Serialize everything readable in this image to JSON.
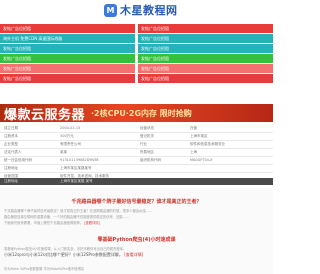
{
  "header": {
    "logo_mark": "M",
    "logo_text": "木星教程网"
  },
  "banners": {
    "left": [
      {
        "label": "发帖广告位招租",
        "color": "red"
      },
      {
        "label": "海外主机 免费CDN 高速国际线路",
        "color": "teal"
      },
      {
        "label": "发帖广告位招租",
        "color": "teal"
      },
      {
        "label": "发帖广告位招租",
        "color": "green"
      },
      {
        "label": "发帖广告位招租",
        "color": "pink"
      },
      {
        "label": "发帖广告位招租",
        "color": "red"
      }
    ],
    "right": [
      {
        "label": "发帖广告位招租",
        "color": "red"
      },
      {
        "label": "发帖广告位招租",
        "color": "teal"
      },
      {
        "label": "发帖广告位招租",
        "color": "teal"
      },
      {
        "label": "发帖广告位招租",
        "color": "green"
      },
      {
        "label": "发帖广告位招租",
        "color": "pink"
      },
      {
        "label": "发帖广告位招租",
        "color": "red"
      }
    ]
  },
  "big_banner": {
    "title": "爆款云服务器",
    "subtitle": "·2核CPU·2G内存 限时抢购"
  },
  "info_rows": [
    [
      "成立日期",
      "2004-02-15",
      "经营状态",
      "在营"
    ],
    [
      "注册资本",
      "300万元",
      "登记机关",
      "上海市某区"
    ],
    [
      "企业类型",
      "有限责任公司",
      "行业",
      "软件和信息技术服务业"
    ],
    [
      "法定代表人",
      "某某",
      "所属地区",
      "上海"
    ],
    [
      "统一社会信用代码",
      "913101139082DYN38",
      "组织机构代码",
      "MA0GFT04-X"
    ],
    [
      "注册地址",
      "上海市某区某路某号",
      "",
      ""
    ],
    [
      "经营范围",
      "软件开发、技术咨询、技术服务",
      "",
      ""
    ]
  ],
  "dark_row": {
    "label": "注册地址",
    "value": "上海市某区某路 某号"
  },
  "section2": {
    "q1_title": "千兆路由器哪个牌子最好信号最稳定？谁才是真正的王者？",
    "q1_lines": [
      "千兆路由器哪个牌子最好信号最稳定？谁才是真正的王者？在选购路由器的时候，很多人都会纠结……",
      "路由器是连接互联网的重要设备，一个好的路由器不仅能够提供稳定的信号，还能……",
      "下面我们就来看看，市面上哪些千兆路由器值得推荐。"
    ],
    "q1_link": "[查看详情]",
    "q2_title": "零基础Python爬虫(4)小时速成课",
    "q2_lines": [
      "零基础Python爬虫4小时速成课，从入门到实战，手把手教你写出自己的爬虫程序。",
      "小米12spro与小米12s对比哪个更好？小米12SPro参数配置详解。"
    ],
    "q2_link": "[查看详情]",
    "footer": "华为Mate 50Pro参数配置 华为Mate50Pro值不值得买"
  },
  "colors": {
    "red": "#ea3b3b",
    "teal": "#23b3b9",
    "green": "#33c23c",
    "pink": "#f57070",
    "banner_accent": "#ffe19e"
  }
}
